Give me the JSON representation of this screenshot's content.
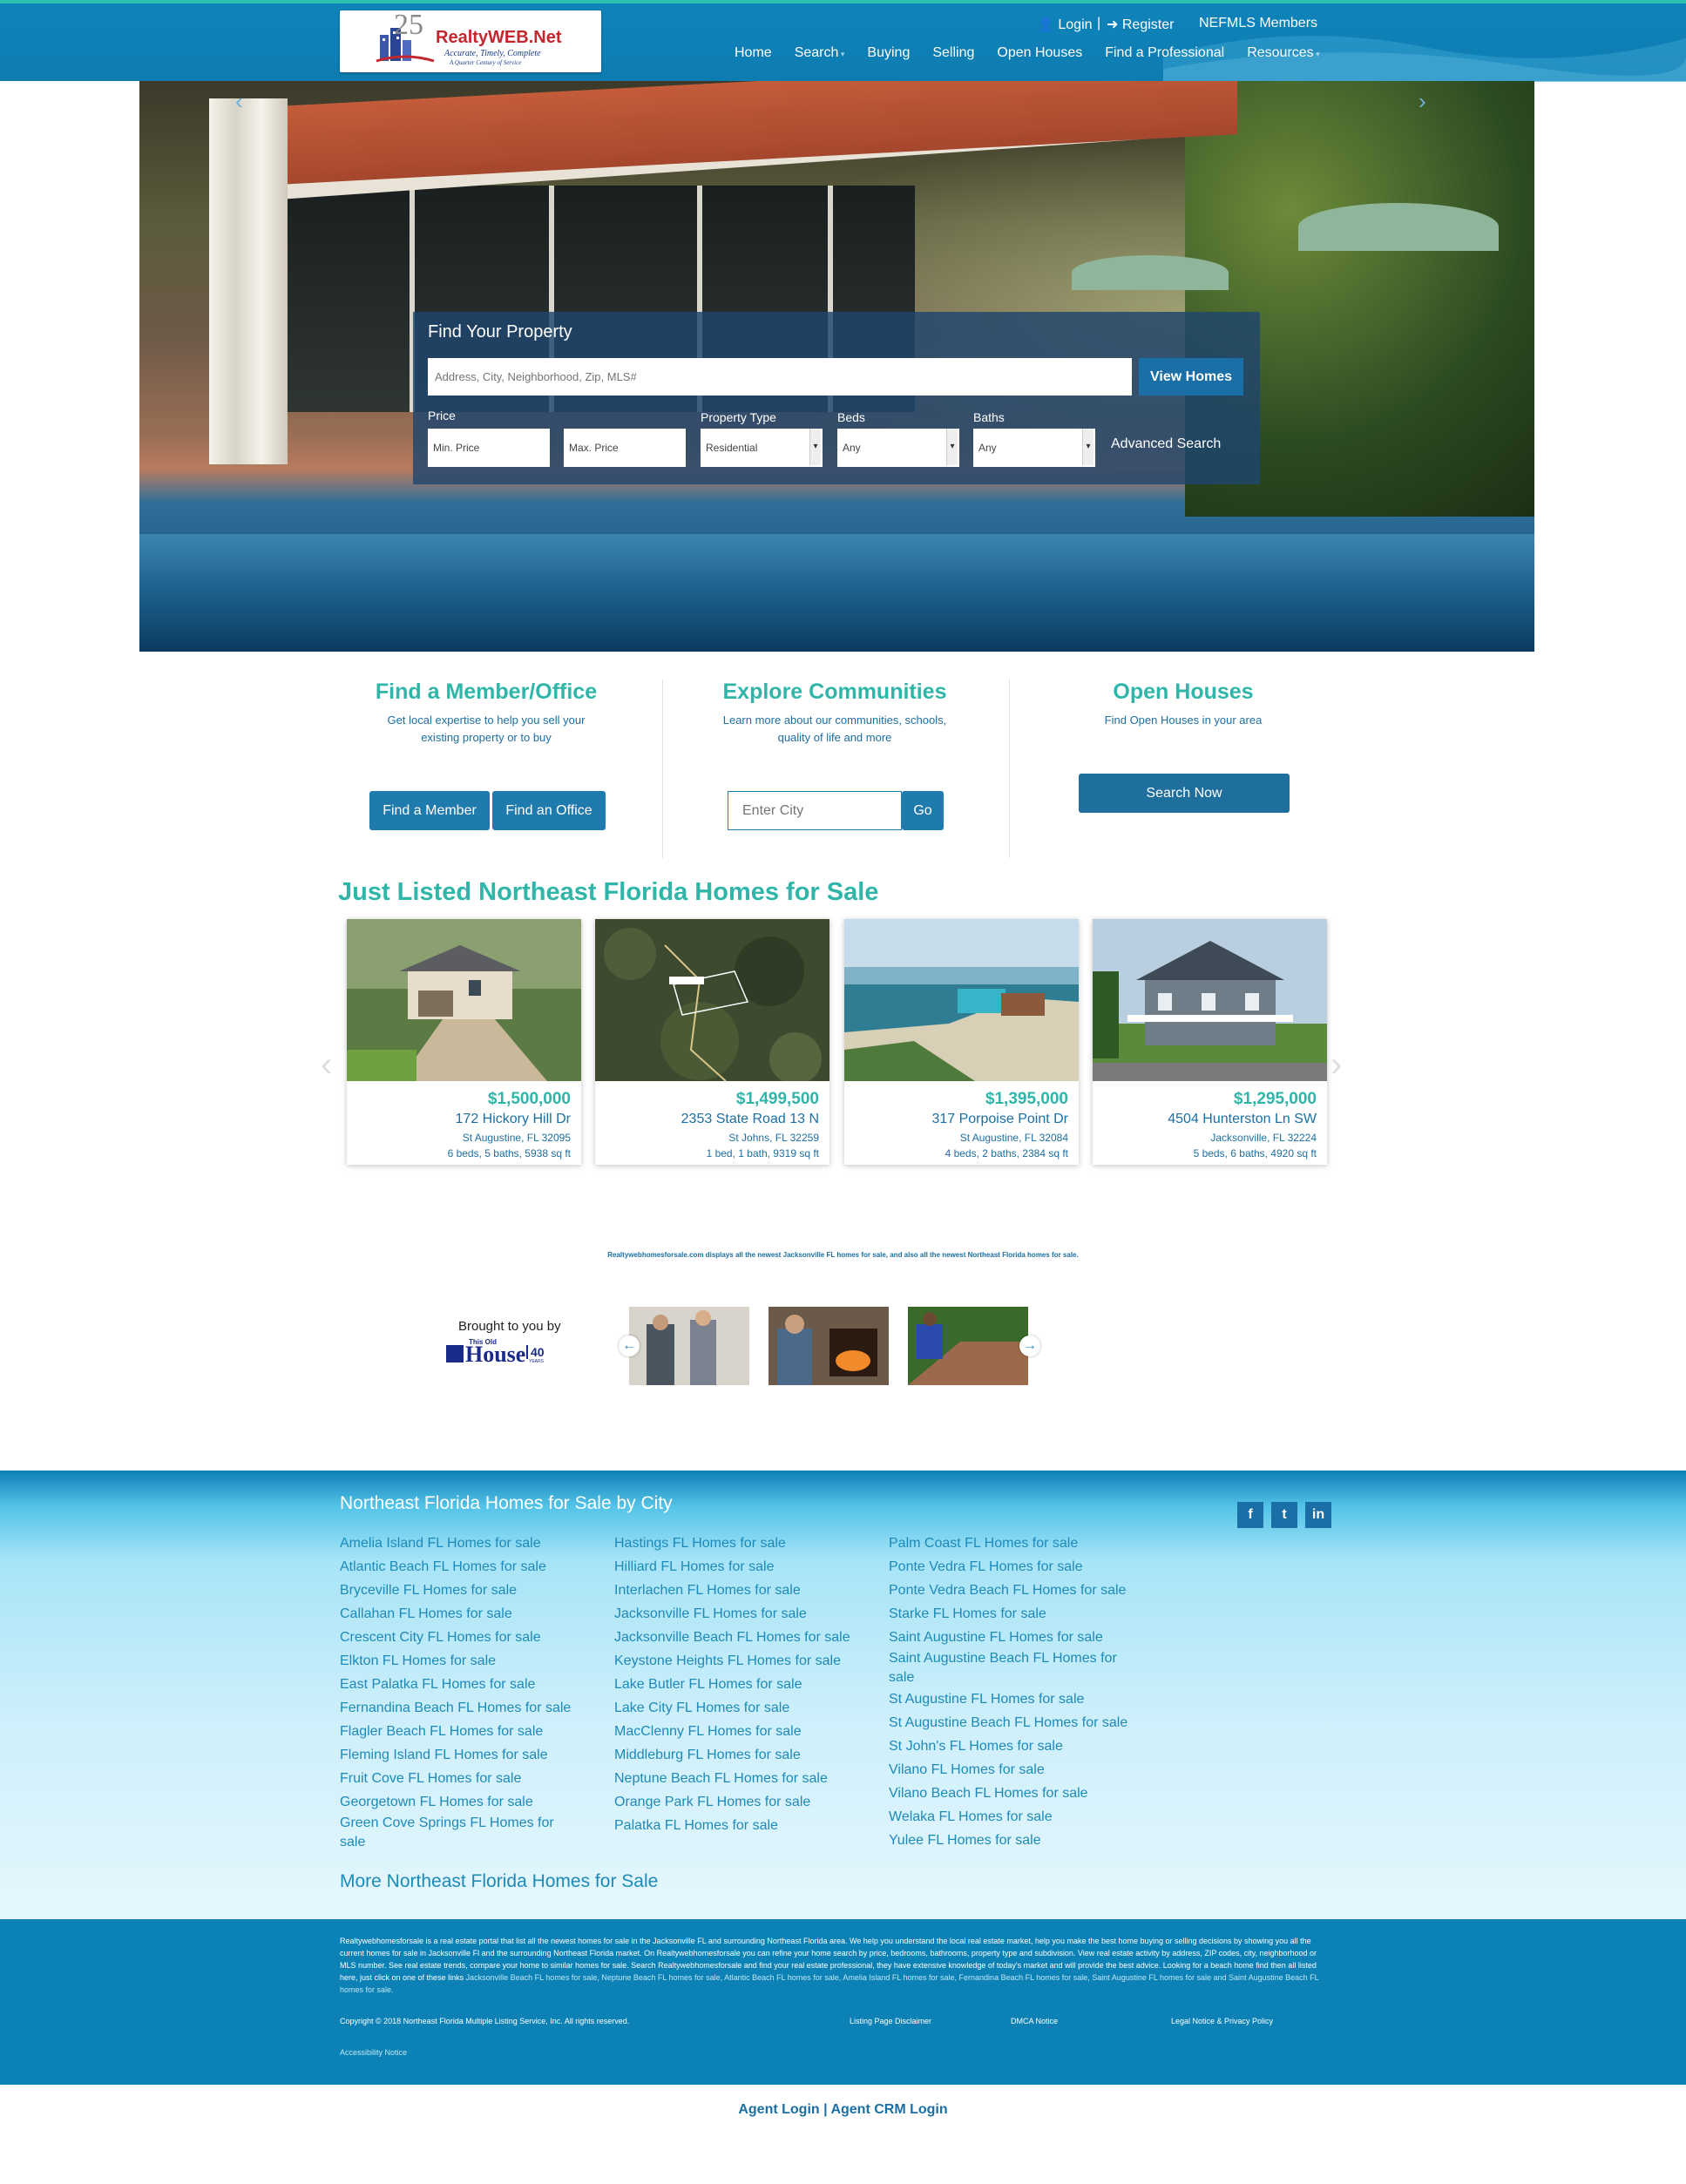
{
  "header": {
    "logo": {
      "name": "RealtyWEB.Net",
      "tagline": "Accurate, Timely, Complete",
      "subtagline": "A Quarter Century of Service",
      "emblem": "25"
    },
    "login": "Login",
    "register": "Register",
    "members": "NEFMLS Members",
    "nav": [
      "Home",
      "Search",
      "Buying",
      "Selling",
      "Open Houses",
      "Find a Professional",
      "Resources"
    ]
  },
  "search": {
    "title": "Find Your Property",
    "placeholder": "Address, City, Neighborhood, Zip, MLS#",
    "view_button": "View Homes",
    "price_label": "Price",
    "min_price": "Min. Price",
    "max_price": "Max. Price",
    "type_label": "Property Type",
    "type_value": "Residential",
    "beds_label": "Beds",
    "beds_value": "Any",
    "baths_label": "Baths",
    "baths_value": "Any",
    "advanced": "Advanced Search"
  },
  "columns": {
    "member": {
      "title": "Find a Member/Office",
      "text": "Get local expertise to help you sell your existing property or to buy",
      "btn_member": "Find a Member",
      "btn_office": "Find an Office"
    },
    "communities": {
      "title": "Explore Communities",
      "text": "Learn more about our communities, schools, quality of life and more",
      "placeholder": "Enter City",
      "go": "Go"
    },
    "open": {
      "title": "Open Houses",
      "text": "Find Open Houses in your area",
      "btn": "Search Now"
    }
  },
  "listings": {
    "title": "Just Listed Northeast Florida Homes for Sale",
    "items": [
      {
        "price": "$1,500,000",
        "address": "172 Hickory Hill Dr",
        "city": "St Augustine, FL 32095",
        "info": "6 beds, 5 baths, 5938 sq ft"
      },
      {
        "price": "$1,499,500",
        "address": "2353 State Road 13 N",
        "city": "St Johns, FL 32259",
        "info": "1 bed, 1 bath, 9319 sq ft"
      },
      {
        "price": "$1,395,000",
        "address": "317 Porpoise Point Dr",
        "city": "St Augustine, FL 32084",
        "info": "4 beds, 2 baths, 2384 sq ft"
      },
      {
        "price": "$1,295,000",
        "address": "4504 Hunterston Ln SW",
        "city": "Jacksonville, FL 32224",
        "info": "5 beds, 6 baths, 4920 sq ft"
      }
    ]
  },
  "blurb": "Realtywebhomesforsale.com displays all the newest Jacksonville FL homes for sale, and also all the newest Northeast Florida homes for sale.",
  "toh": {
    "brought": "Brought to you by",
    "brand_small": "This Old",
    "brand": "House",
    "years": "40",
    "years_label": "YEARS"
  },
  "footer": {
    "title": "Northeast Florida Homes for Sale by City",
    "col1": [
      "Amelia Island FL Homes for sale",
      "Atlantic Beach FL Homes for sale",
      "Bryceville FL Homes for sale",
      "Callahan FL Homes for sale",
      "Crescent City FL Homes for sale",
      "Elkton FL Homes for sale",
      "East Palatka FL Homes for sale",
      "Fernandina Beach FL Homes for sale",
      "Flagler Beach FL Homes for sale",
      "Fleming Island FL Homes for sale",
      "Fruit Cove FL Homes for sale",
      "Georgetown FL Homes for sale",
      "Green Cove Springs FL Homes for",
      "sale"
    ],
    "col2": [
      "Hastings FL Homes for sale",
      "Hilliard FL Homes for sale",
      "Interlachen FL Homes for sale",
      "Jacksonville FL Homes for sale",
      "Jacksonville Beach FL Homes for sale",
      "Keystone Heights FL Homes for sale",
      "Lake Butler FL Homes for sale",
      "Lake City FL Homes for sale",
      "MacClenny FL Homes for sale",
      "Middleburg FL Homes for sale",
      "Neptune Beach FL Homes for sale",
      "Orange Park FL Homes for sale",
      "Palatka FL Homes for sale"
    ],
    "col3": [
      "Palm Coast FL Homes for sale",
      "Ponte Vedra FL Homes for sale",
      "Ponte Vedra Beach FL Homes for sale",
      "Starke FL Homes for sale",
      "Saint Augustine FL Homes for sale",
      "Saint Augustine Beach FL Homes for",
      "sale",
      "St Augustine FL Homes for sale",
      "St Augustine Beach FL Homes for sale",
      "St John's FL Homes for sale",
      "Vilano FL Homes for sale",
      "Vilano Beach FL Homes for sale",
      "Welaka FL Homes for sale",
      "Yulee FL Homes for sale"
    ],
    "more": "More Northeast Florida Homes for Sale",
    "social": [
      "f",
      "t",
      "in"
    ]
  },
  "legal": {
    "text": "Realtywebhomesforsale is a real estate portal that list all the newest homes for sale in the Jacksonville FL and surrounding Northeast Florida area. We help you understand the local real estate market, help you make the best home buying or selling decisions by showing you all the current homes for sale in Jacksonville Fl and the surrounding Northeast Florida market. On Realtywebhomesforsale you can refine your home search by price, bedrooms, bathrooms, property type and subdivision. View real estate activity by address, ZIP codes, city, neighborhood or MLS number. See real estate trends, compare your home to similar homes for sale. Search Realtywebhomesforsale and find your real estate professional, they have extensive knowledge of today's market and will provide the best advice. Looking for a beach home find then all listed here, just click on one of these links",
    "links": "Jacksonville Beach FL homes for sale, Neptune Beach FL homes for sale, Atlantic Beach FL homes for sale, Amelia Island FL homes for sale, Fernandina Beach FL homes for sale, Saint Augustine FL homes for sale and Saint Augustine Beach FL homes for sale.",
    "copyright": "Copyright © 2018 Northeast Florida Multiple Listing Service, Inc. All rights reserved.",
    "disclaimer": "Listing Page Disclaimer",
    "dmca": "DMCA Notice",
    "privacy": "Legal Notice & Privacy Policy",
    "accessibility": "Accessibility Notice"
  },
  "agent": {
    "login": "Agent Login",
    "sep": "|",
    "crm": "Agent CRM Login"
  }
}
